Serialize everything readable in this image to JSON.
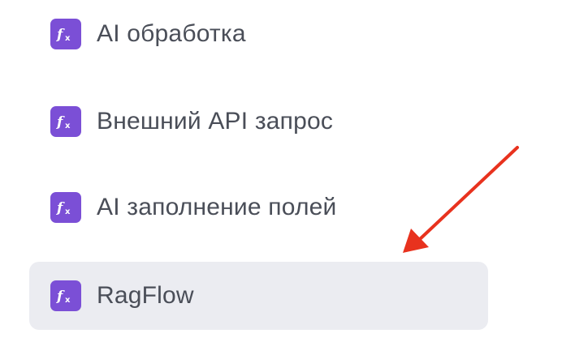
{
  "menu": {
    "items": [
      {
        "label": "AI обработка",
        "icon": "fx-icon",
        "selected": false
      },
      {
        "label": "Внешний API запрос",
        "icon": "fx-icon",
        "selected": false
      },
      {
        "label": "AI заполнение полей",
        "icon": "fx-icon",
        "selected": false
      },
      {
        "label": "RagFlow",
        "icon": "fx-icon",
        "selected": true
      }
    ]
  },
  "colors": {
    "icon_background": "#7b4fd6",
    "selected_background": "#ebecf1",
    "text": "#4a4e58",
    "annotation_arrow": "#e8321e"
  }
}
